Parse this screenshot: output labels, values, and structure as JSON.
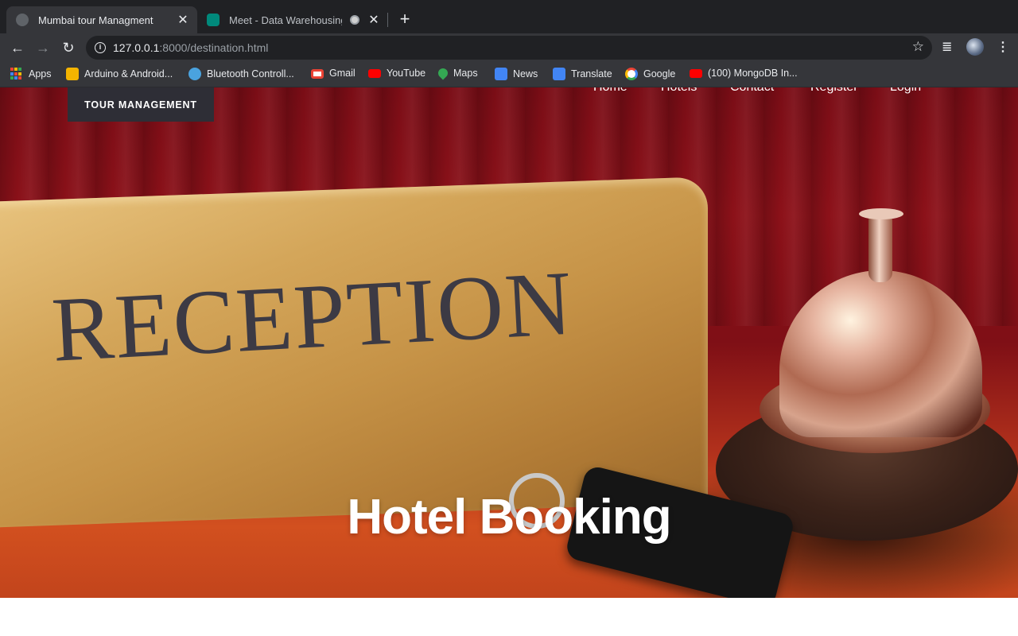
{
  "tabs": [
    {
      "title": "Mumbai tour Managment",
      "active": true
    },
    {
      "title": "Meet - Data Warehousing a",
      "active": false
    }
  ],
  "toolbar": {
    "url_host": "127.0.0.1",
    "url_rest": ":8000/destination.html"
  },
  "bookmarks": [
    {
      "label": "Apps",
      "icon": "apps-grid-icon"
    },
    {
      "label": "Arduino & Android...",
      "icon": "arduino-icon",
      "color": "#f4b400"
    },
    {
      "label": "Bluetooth Controll...",
      "icon": "globe-icon",
      "color": "#4aa3df"
    },
    {
      "label": "Gmail",
      "icon": "gmail-icon",
      "color": "#ea4335"
    },
    {
      "label": "YouTube",
      "icon": "youtube-icon",
      "color": "#ff0000"
    },
    {
      "label": "Maps",
      "icon": "maps-icon",
      "color": "#34a853"
    },
    {
      "label": "News",
      "icon": "news-icon",
      "color": "#4285f4"
    },
    {
      "label": "Translate",
      "icon": "translate-icon",
      "color": "#4285f4"
    },
    {
      "label": "Google",
      "icon": "google-icon",
      "color": "#ffffff"
    },
    {
      "label": "(100) MongoDB In...",
      "icon": "youtube-icon",
      "color": "#ff0000"
    }
  ],
  "site": {
    "brand": "TOUR MANAGEMENT",
    "nav": [
      "Home",
      "Hotels",
      "Contact",
      "Register",
      "Login"
    ],
    "hero_title": "Hotel Booking",
    "hero_sign_text": "RECEPTION"
  }
}
